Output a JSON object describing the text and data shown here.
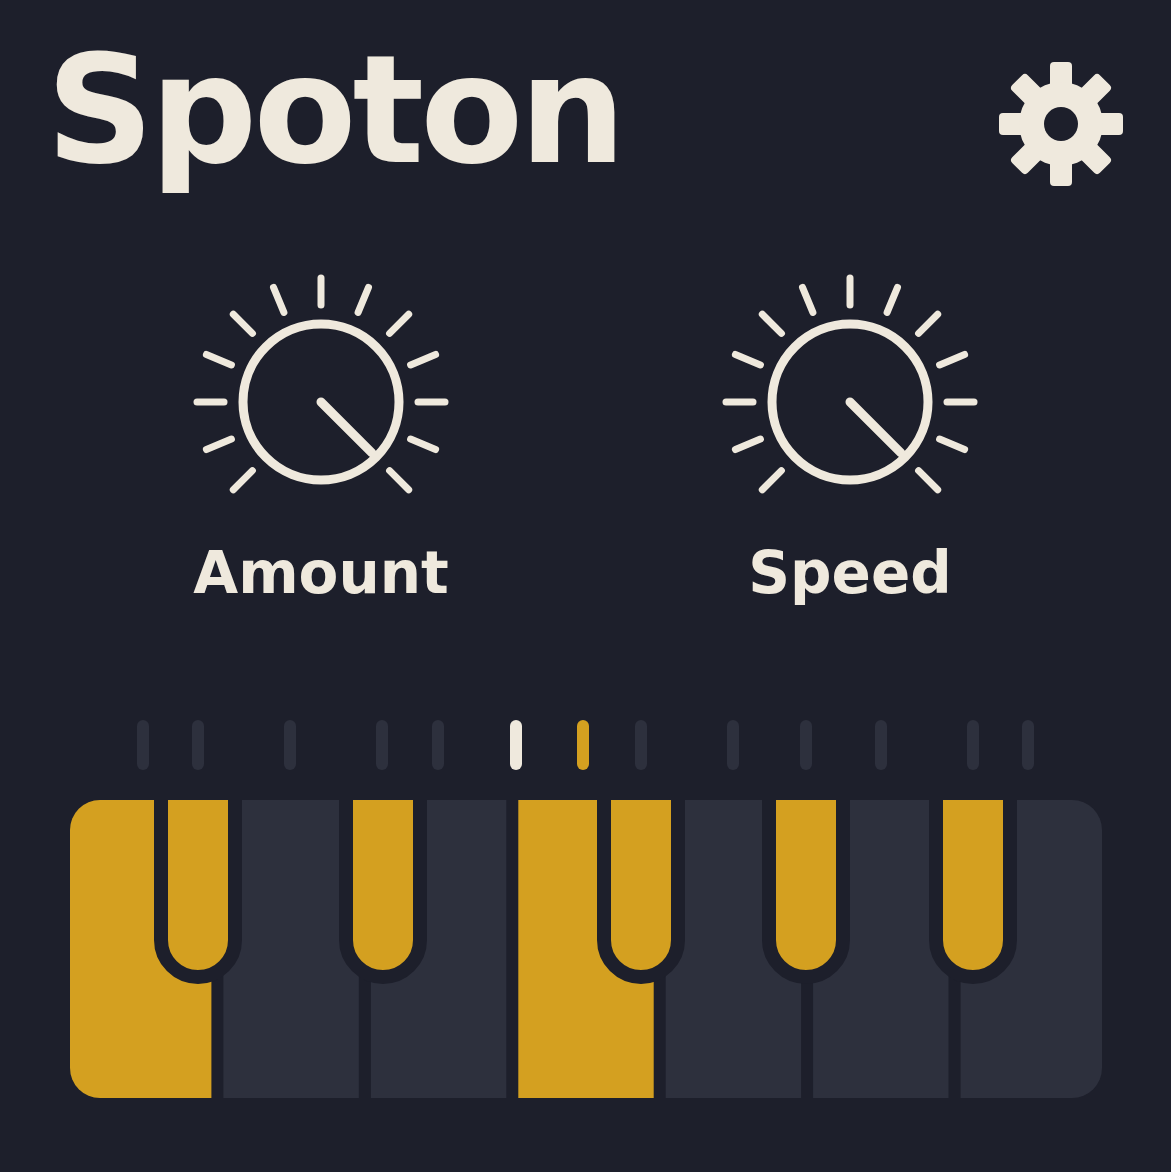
{
  "title": "Spoton",
  "knobs": [
    {
      "label": "Amount"
    },
    {
      "label": "Speed"
    }
  ],
  "indicators": [
    {
      "color": "#2d303d"
    },
    {
      "color": "#2d303d"
    },
    {
      "color": "#2d303d"
    },
    {
      "color": "#2d303d"
    },
    {
      "color": "#2d303d"
    },
    {
      "color": "#efe9dd"
    },
    {
      "color": "#d4a020"
    },
    {
      "color": "#2d303d"
    },
    {
      "color": "#2d303d"
    },
    {
      "color": "#2d303d"
    },
    {
      "color": "#2d303d"
    },
    {
      "color": "#2d303d"
    },
    {
      "color": "#2d303d"
    }
  ],
  "keyboard": {
    "white_keys": [
      {
        "selected": true
      },
      {
        "selected": false
      },
      {
        "selected": false
      },
      {
        "selected": true
      },
      {
        "selected": false
      },
      {
        "selected": false
      },
      {
        "selected": false
      }
    ],
    "black_keys": [
      {
        "selected": true
      },
      {
        "selected": true
      },
      {
        "selected": true
      },
      {
        "selected": true
      },
      {
        "selected": true
      }
    ]
  }
}
